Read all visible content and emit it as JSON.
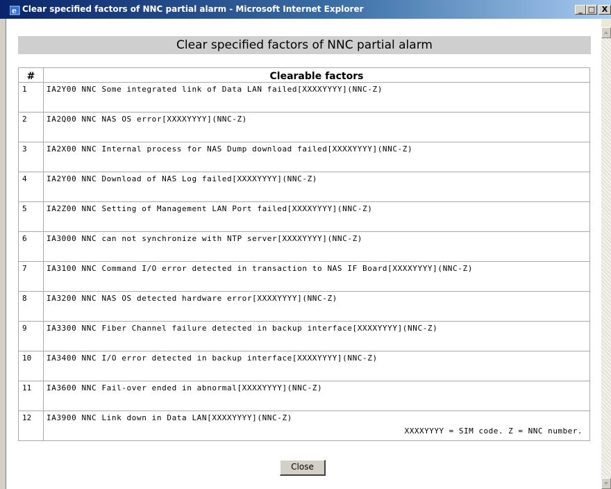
{
  "window": {
    "title": "Clear specified factors of NNC partial alarm - Microsoft Internet Explorer",
    "controls": {
      "minimize": "_",
      "maximize": "□",
      "close": "X"
    }
  },
  "page": {
    "heading": "Clear specified factors of NNC partial alarm",
    "table": {
      "headers": {
        "number": "#",
        "factors": "Clearable factors"
      },
      "rows": [
        {
          "num": "1",
          "text": "IA2Y00 NNC Some integrated link of Data LAN failed[XXXXYYYY](NNC-Z)"
        },
        {
          "num": "2",
          "text": "IA2Q00 NNC NAS OS error[XXXXYYYY](NNC-Z)"
        },
        {
          "num": "3",
          "text": "IA2X00 NNC Internal process for NAS Dump download failed[XXXXYYYY](NNC-Z)"
        },
        {
          "num": "4",
          "text": "IA2Y00 NNC Download of NAS Log failed[XXXXYYYY](NNC-Z)"
        },
        {
          "num": "5",
          "text": "IA2Z00 NNC Setting of Management LAN Port failed[XXXXYYYY](NNC-Z)"
        },
        {
          "num": "6",
          "text": "IA3000 NNC can not synchronize with NTP server[XXXXYYYY](NNC-Z)"
        },
        {
          "num": "7",
          "text": "IA3100 NNC Command I/O error detected in transaction to NAS IF Board[XXXXYYYY](NNC-Z)"
        },
        {
          "num": "8",
          "text": "IA3200 NNC NAS OS detected hardware error[XXXXYYYY](NNC-Z)"
        },
        {
          "num": "9",
          "text": "IA3300 NNC Fiber Channel failure detected in backup interface[XXXXYYYY](NNC-Z)"
        },
        {
          "num": "10",
          "text": "IA3400 NNC I/O error detected in backup interface[XXXXYYYY](NNC-Z)"
        },
        {
          "num": "11",
          "text": "IA3600 NNC Fail-over ended in abnormal[XXXXYYYY](NNC-Z)"
        },
        {
          "num": "12",
          "text": "IA3900 NNC Link down in Data LAN[XXXXYYYY](NNC-Z)"
        }
      ]
    },
    "note": "XXXXYYYY = SIM code. Z = NNC number.",
    "close_label": "Close"
  },
  "icons": {
    "app": "ie-icon"
  }
}
